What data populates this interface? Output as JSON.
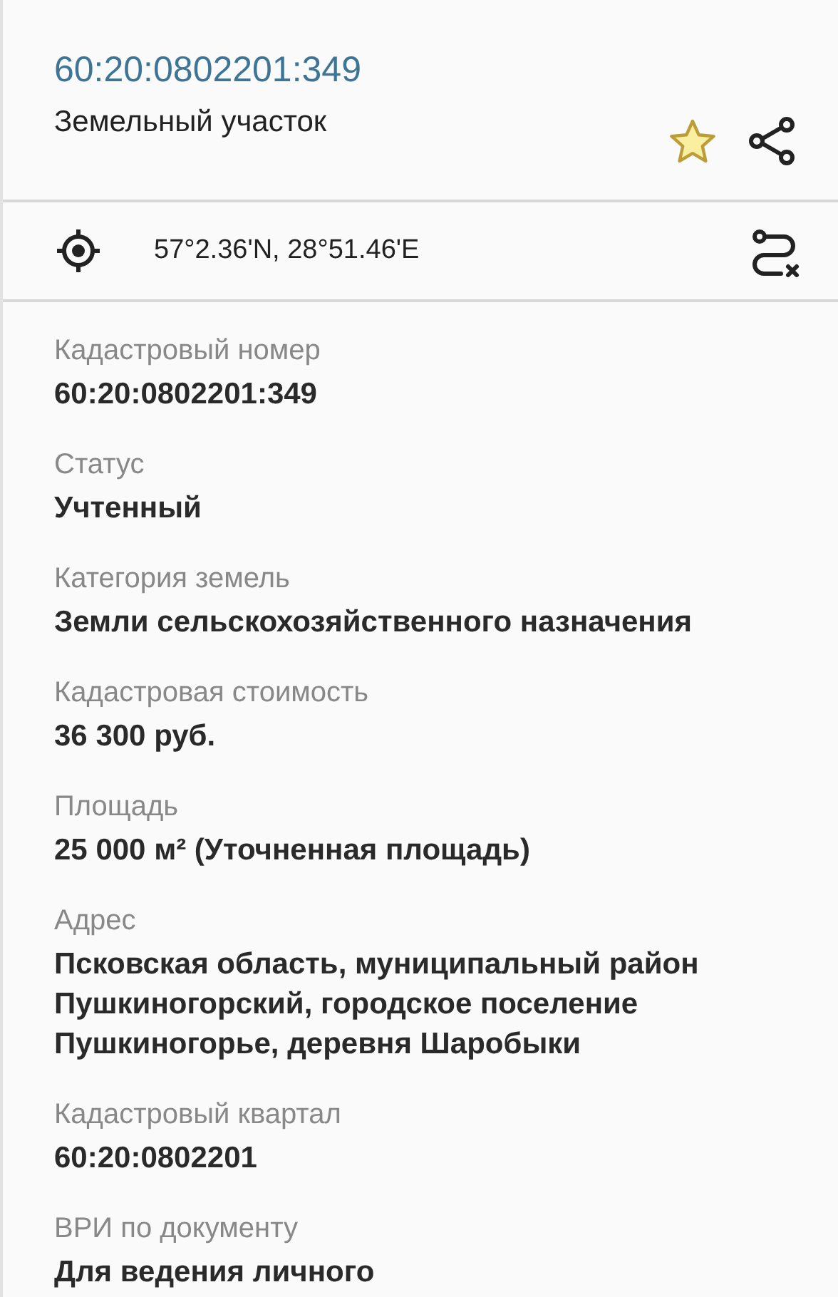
{
  "header": {
    "title": "60:20:0802201:349",
    "subtitle": "Земельный участок",
    "favorite": true
  },
  "location": {
    "coordinates": "57°2.36'N, 28°51.46'E"
  },
  "fields": [
    {
      "label": "Кадастровый номер",
      "value": "60:20:0802201:349"
    },
    {
      "label": "Статус",
      "value": "Учтенный"
    },
    {
      "label": "Категория земель",
      "value": "Земли сельскохозяйственного назначения"
    },
    {
      "label": "Кадастровая стоимость",
      "value": "36 300 руб."
    },
    {
      "label": "Площадь",
      "value": "25 000 м² (Уточненная площадь)"
    },
    {
      "label": "Адрес",
      "value": "Псковская область, муниципальный район Пушкиногорский, городское поселение Пушкиногорье, деревня Шаробыки"
    },
    {
      "label": "Кадастровый квартал",
      "value": "60:20:0802201"
    },
    {
      "label": "ВРИ по документу",
      "value": "Для ведения личного"
    }
  ]
}
